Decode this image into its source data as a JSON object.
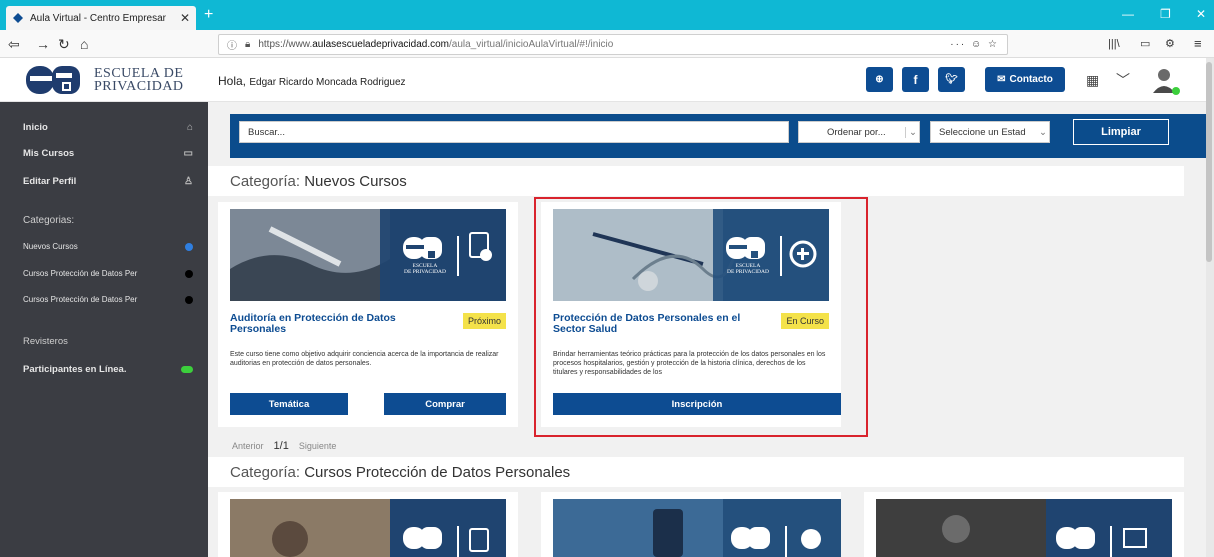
{
  "browser": {
    "tab_title": "Aula Virtual - Centro Empresar",
    "url_prefix": "https://www.",
    "url_host": "aulasescueladeprivacidad.com",
    "url_rest": "/aula_virtual/inicioAulaVirtual/#!/inicio",
    "url_actions": "··· ☺ ☆"
  },
  "header": {
    "logo_line1": "ESCUELA DE",
    "logo_line2": "PRIVACIDAD",
    "greeting": "Hola,",
    "user_name": "Edgar Ricardo Moncada Rodriguez",
    "contact_label": "Contacto"
  },
  "sidebar": {
    "items": [
      {
        "label": "Inicio"
      },
      {
        "label": "Mis Cursos"
      },
      {
        "label": "Editar Perfil"
      }
    ],
    "categories_title": "Categorias:",
    "categories": [
      {
        "label": "Nuevos Cursos",
        "dot_color": "#2f7fe0"
      },
      {
        "label": "Cursos Protección de Datos Per",
        "dot_color": "#000000"
      },
      {
        "label": "Cursos Protección de Datos Per",
        "dot_color": "#000000"
      }
    ],
    "registers": "Revisteros",
    "online": "Participantes en Línea."
  },
  "filters": {
    "search_placeholder": "Buscar...",
    "order_label": "Ordenar por...",
    "state_label": "Seleccione un Estad",
    "clear_label": "Limpiar"
  },
  "section1": {
    "prefix": "Categoría:",
    "name": "Nuevos Cursos",
    "cards": [
      {
        "title": "Auditoría en Protección de Datos Personales",
        "badge": "Próximo",
        "description": "Este curso tiene como objetivo adquirir conciencia acerca de la importancia de realizar auditorias en protección de datos personales.",
        "btn1": "Temática",
        "btn2": "Comprar"
      },
      {
        "title": "Protección de Datos Personales en el Sector Salud",
        "badge": "En Curso",
        "description": "Brindar herramientas teórico prácticas para la protección de los datos personales en los procesos hospitalarios, gestión y protección de la historia clínica, derechos de los titulares y responsabilidades de los",
        "btn1": "Inscripción"
      }
    ],
    "pager": {
      "prev": "Anterior",
      "current": "1/1",
      "next": "Siguiente"
    }
  },
  "section2": {
    "prefix": "Categoría:",
    "name": "Cursos Protección de Datos Personales"
  },
  "logo_small": {
    "line1": "ESCUELA",
    "line2": "DE PRIVACIDAD"
  },
  "colors": {
    "primary": "#0d4c92",
    "tabbar": "#0fb8d4",
    "sidebar": "#3b3d43",
    "highlight": "#d9232d"
  }
}
